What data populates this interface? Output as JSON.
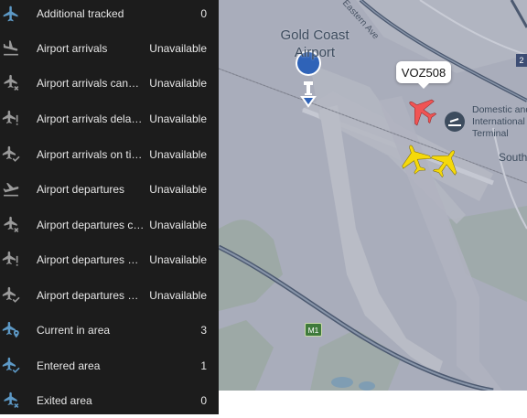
{
  "sidebar": {
    "items": [
      {
        "label": "Additional tracked",
        "value": "0",
        "icon": "plane-plus-icon"
      },
      {
        "label": "Airport arrivals",
        "value": "Unavailable",
        "icon": "plane-landing-icon"
      },
      {
        "label": "Airport arrivals cancelled",
        "value": "Unavailable",
        "icon": "plane-cancel-icon"
      },
      {
        "label": "Airport arrivals delayed",
        "value": "Unavailable",
        "icon": "plane-delay-icon"
      },
      {
        "label": "Airport arrivals on time",
        "value": "Unavailable",
        "icon": "plane-check-icon"
      },
      {
        "label": "Airport departures",
        "value": "Unavailable",
        "icon": "plane-takeoff-icon"
      },
      {
        "label": "Airport departures cancelled",
        "value": "Unavailable",
        "icon": "plane-cancel-icon"
      },
      {
        "label": "Airport departures delayed",
        "value": "Unavailable",
        "icon": "plane-delay-icon"
      },
      {
        "label": "Airport departures on time",
        "value": "Unavailable",
        "icon": "plane-check-icon"
      },
      {
        "label": "Current in area",
        "value": "3",
        "icon": "plane-marker-icon"
      },
      {
        "label": "Entered area",
        "value": "1",
        "icon": "plane-check-icon"
      },
      {
        "label": "Exited area",
        "value": "0",
        "icon": "plane-cancel-icon"
      }
    ],
    "icon_color": "#5d99c6"
  },
  "map": {
    "airport_label": "Gold Coast Airport",
    "terminal_label": "Domestic and International Terminal",
    "south_label": "South",
    "road_label": "Eastern Ave",
    "motorway_label": "M1",
    "shield_label": "2",
    "selected_flight_callsign": "VOZ508",
    "selected_aircraft_color": "#f05454",
    "other_aircraft_color": "#f5d90a"
  }
}
